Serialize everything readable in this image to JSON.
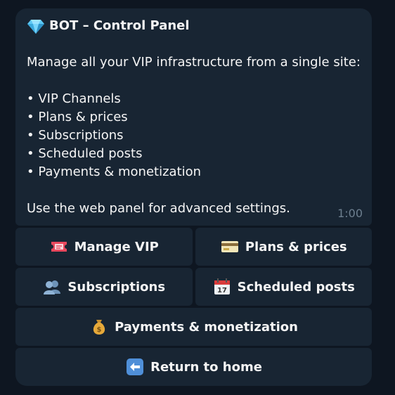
{
  "message": {
    "title_emoji": "gem-icon",
    "title": "BOT – Control Panel",
    "intro": "Manage all your VIP infrastructure from a single site:",
    "list": [
      "• VIP Channels",
      "• Plans & prices",
      "• Subscriptions",
      "• Scheduled posts",
      "• Payments & monetization"
    ],
    "outro": "Use the web panel for advanced settings.",
    "time": "1:00"
  },
  "keyboard": {
    "manage_vip": "Manage VIP",
    "plans_prices": "Plans & prices",
    "subscriptions": "Subscriptions",
    "scheduled_posts": "Scheduled posts",
    "payments": "Payments & monetization",
    "return_home": "Return to home"
  },
  "colors": {
    "background": "#0e1621",
    "bubble": "#182533",
    "text": "#f5f5f5",
    "time": "#6d7f8f"
  }
}
